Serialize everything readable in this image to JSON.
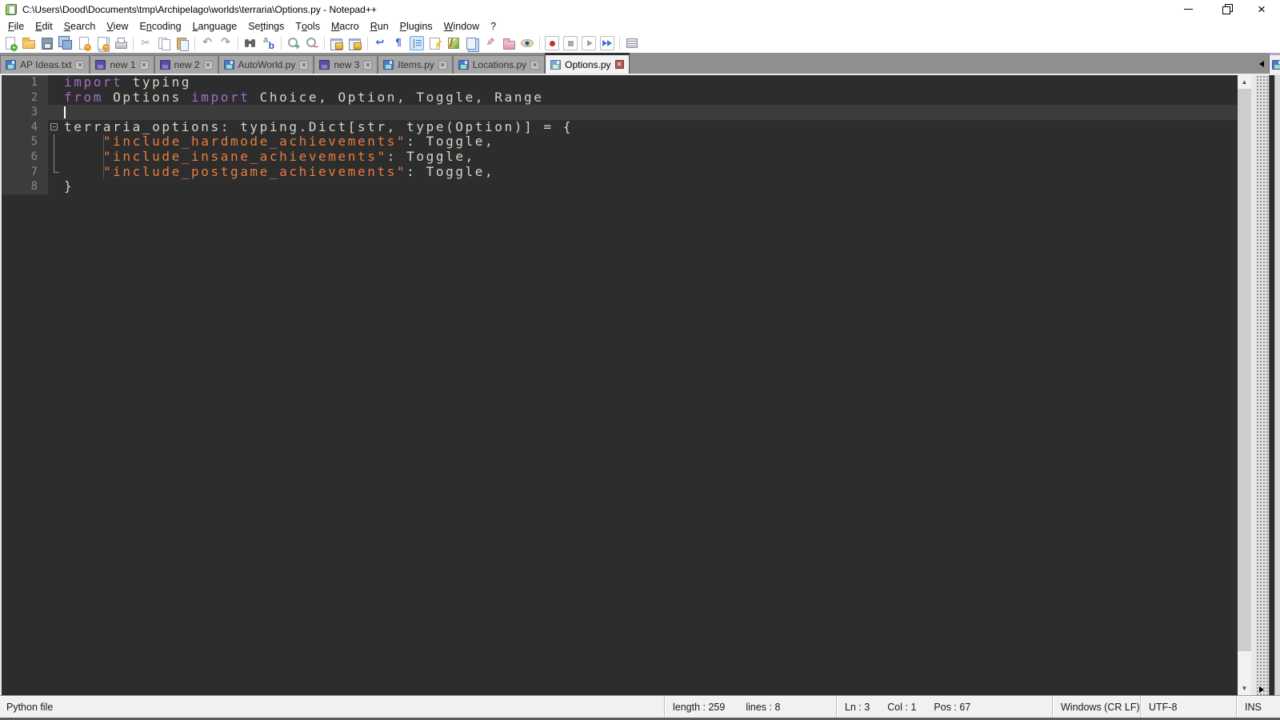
{
  "window": {
    "title": "C:\\Users\\Dood\\Documents\\tmp\\Archipelago\\worlds\\terraria\\Options.py - Notepad++"
  },
  "menu": {
    "items": [
      {
        "label": "File",
        "u": 0
      },
      {
        "label": "Edit",
        "u": 0
      },
      {
        "label": "Search",
        "u": 0
      },
      {
        "label": "View",
        "u": 0
      },
      {
        "label": "Encoding",
        "u": 1
      },
      {
        "label": "Language",
        "u": 0
      },
      {
        "label": "Settings",
        "u": 2
      },
      {
        "label": "Tools",
        "u": 1
      },
      {
        "label": "Macro",
        "u": 0
      },
      {
        "label": "Run",
        "u": 0
      },
      {
        "label": "Plugins",
        "u": 0
      },
      {
        "label": "Window",
        "u": 0
      },
      {
        "label": "?",
        "u": -1
      }
    ]
  },
  "toolbar": {
    "active": "indent-guide",
    "groups": [
      [
        "new-file",
        "open-file",
        "save",
        "save-all",
        "close-doc",
        "close-all",
        "print"
      ],
      [
        "cut",
        "copy",
        "paste"
      ],
      [
        "undo",
        "redo"
      ],
      [
        "find",
        "replace"
      ],
      [
        "zoom-in",
        "zoom-out"
      ],
      [
        "sync-v",
        "sync-h"
      ],
      [
        "word-wrap",
        "show-all-chars",
        "indent-guide",
        "function-list",
        "doc-map",
        "doc-list",
        "edit-marker",
        "folder-workspace",
        "monitoring"
      ],
      [
        "macro-record",
        "macro-stop",
        "macro-play",
        "macro-run-multi"
      ],
      [
        "macro-save"
      ]
    ]
  },
  "tabs": [
    {
      "label": "AP Ideas.txt",
      "icon": "blue",
      "active": false
    },
    {
      "label": "new 1",
      "icon": "purple",
      "active": false
    },
    {
      "label": "new 2",
      "icon": "purple",
      "active": false
    },
    {
      "label": "AutoWorld.py",
      "icon": "blue",
      "active": false
    },
    {
      "label": "new 3",
      "icon": "purple",
      "active": false
    },
    {
      "label": "Items.py",
      "icon": "blue",
      "active": false
    },
    {
      "label": "Locations.py",
      "icon": "blue",
      "active": false
    },
    {
      "label": "Options.py",
      "icon": "active",
      "active": true
    }
  ],
  "editor": {
    "colors": {
      "background": "#2d2d2d",
      "margin": "#3c3c3c",
      "current_line": "#3c3c3c",
      "keyword": "#a46cc8",
      "default": "#d6d6cc",
      "string": "#e87d3e",
      "line_number": "#8a8a8a",
      "caret": "#ffffff"
    },
    "lines": [
      {
        "num": 1,
        "segments": [
          {
            "c": "k",
            "t": "import"
          },
          {
            "c": "d",
            "t": " typing"
          }
        ]
      },
      {
        "num": 2,
        "segments": [
          {
            "c": "k",
            "t": "from"
          },
          {
            "c": "d",
            "t": " Options "
          },
          {
            "c": "k",
            "t": "import"
          },
          {
            "c": "d",
            "t": " Choice, Option, Toggle, Range"
          }
        ]
      },
      {
        "num": 3,
        "segments": [],
        "caret": true,
        "current": true
      },
      {
        "num": 4,
        "segments": [
          {
            "c": "d",
            "t": "terraria_options: typing.Dict[str, type(Option)] = {"
          }
        ],
        "fold": "box"
      },
      {
        "num": 5,
        "segments": [
          {
            "c": "d",
            "t": "    "
          },
          {
            "c": "s",
            "t": "\"include_hardmode_achievements\""
          },
          {
            "c": "d",
            "t": ": Toggle,"
          }
        ],
        "fold": "line",
        "guide": true
      },
      {
        "num": 6,
        "segments": [
          {
            "c": "d",
            "t": "    "
          },
          {
            "c": "s",
            "t": "\"include_insane_achievements\""
          },
          {
            "c": "d",
            "t": ": Toggle,"
          }
        ],
        "fold": "line",
        "guide": true
      },
      {
        "num": 7,
        "segments": [
          {
            "c": "d",
            "t": "    "
          },
          {
            "c": "s",
            "t": "\"include_postgame_achievements\""
          },
          {
            "c": "d",
            "t": ": Toggle,"
          }
        ],
        "fold": "corner",
        "guide": true
      },
      {
        "num": 8,
        "segments": [
          {
            "c": "d",
            "t": "}"
          }
        ]
      }
    ]
  },
  "statusbar": {
    "doc_type": "Python file",
    "length": "length : 259",
    "lines": "lines : 8",
    "ln": "Ln : 3",
    "col": "Col : 1",
    "pos": "Pos : 67",
    "eol": "Windows (CR LF)",
    "encoding": "UTF-8",
    "mode": "INS"
  }
}
